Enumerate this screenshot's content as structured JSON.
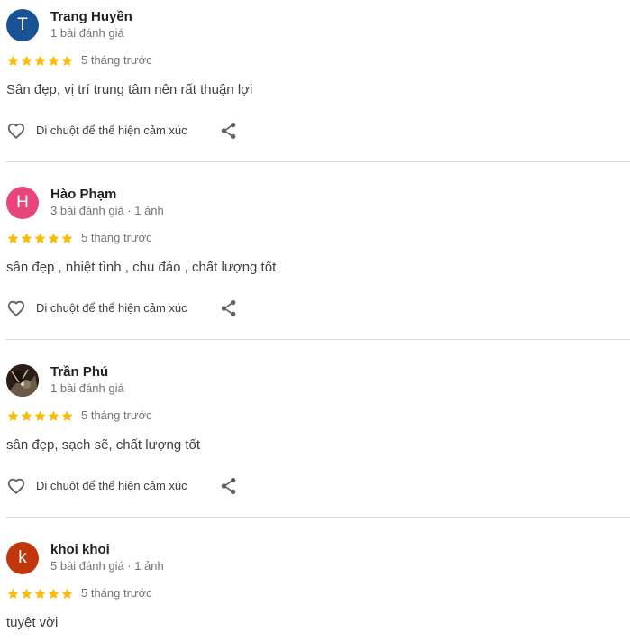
{
  "reviews": [
    {
      "avatar_letter": "T",
      "avatar_color": "#1a5296",
      "name": "Trang Huyền",
      "meta": "1 bài đánh giá",
      "rating": 5,
      "date": "5 tháng trước",
      "text": "Sân đẹp, vị trí trung tâm nên rất thuận lợi",
      "react_label": "Di chuột để thể hiện cảm xúc"
    },
    {
      "avatar_letter": "H",
      "avatar_color": "#e8457b",
      "name": "Hào Phạm",
      "meta": "3 bài đánh giá · 1 ảnh",
      "rating": 5,
      "date": "5 tháng trước",
      "text": "sân đẹp , nhiệt tình , chu đáo , chất lượng tốt",
      "react_label": "Di chuột để thể hiện cảm xúc"
    },
    {
      "avatar_letter": "",
      "avatar_color": "#2a1f18",
      "name": "Trần Phú",
      "meta": "1 bài đánh giá",
      "rating": 5,
      "date": "5 tháng trước",
      "text": "sân đẹp, sạch sẽ, chất lượng tốt",
      "react_label": "Di chuột để thể hiện cảm xúc"
    },
    {
      "avatar_letter": "k",
      "avatar_color": "#c2360c",
      "name": "khoi khoi",
      "meta": "5 bài đánh giá · 1 ảnh",
      "rating": 5,
      "date": "5 tháng trước",
      "text": "tuyệt vời"
    }
  ],
  "colors": {
    "star": "#fbbc04",
    "icon": "#5f6368",
    "divider": "#dadce0"
  },
  "icons": {
    "avatar_photo": "user-photo",
    "star": "star-icon",
    "react": "heart-outline-icon",
    "share": "share-icon"
  }
}
